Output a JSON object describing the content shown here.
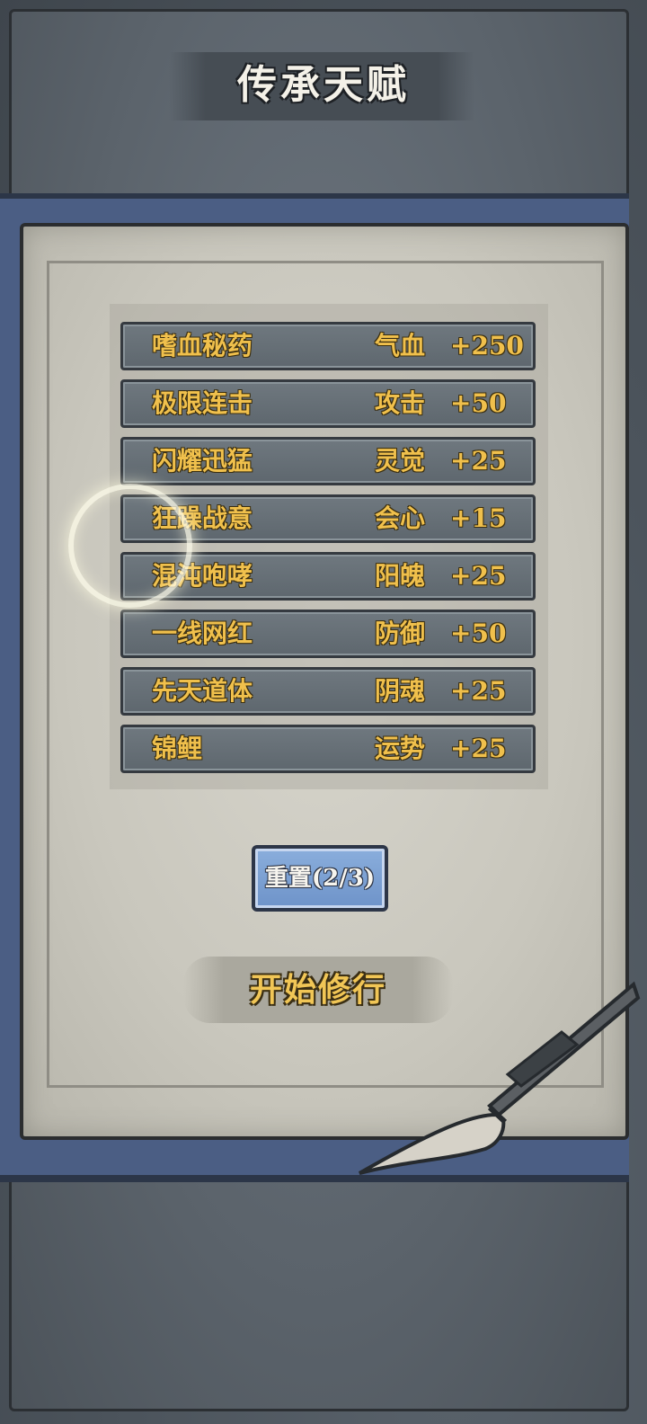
{
  "title": "传承天赋",
  "talents": [
    {
      "name": "嗜血秘药",
      "stat": "气血",
      "value": "+250"
    },
    {
      "name": "极限连击",
      "stat": "攻击",
      "value": "+50"
    },
    {
      "name": "闪耀迅猛",
      "stat": "灵觉",
      "value": "+25"
    },
    {
      "name": "狂躁战意",
      "stat": "会心",
      "value": "+15"
    },
    {
      "name": "混沌咆哮",
      "stat": "阳魄",
      "value": "+25"
    },
    {
      "name": "一线网红",
      "stat": "防御",
      "value": "+50"
    },
    {
      "name": "先天道体",
      "stat": "阴魂",
      "value": "+25"
    },
    {
      "name": "锦鲤",
      "stat": "运势",
      "value": "+25"
    }
  ],
  "reset_label": "重置(2/3)",
  "start_label": "开始修行",
  "colors": {
    "gold_text": "#f0c04c",
    "reset_blue": "#7ea2d4",
    "paper": "#cfcdc4",
    "board_blue": "#4b5e84"
  },
  "icons": {
    "decoration": "brush-icon",
    "highlight": "glow-ring-icon"
  }
}
